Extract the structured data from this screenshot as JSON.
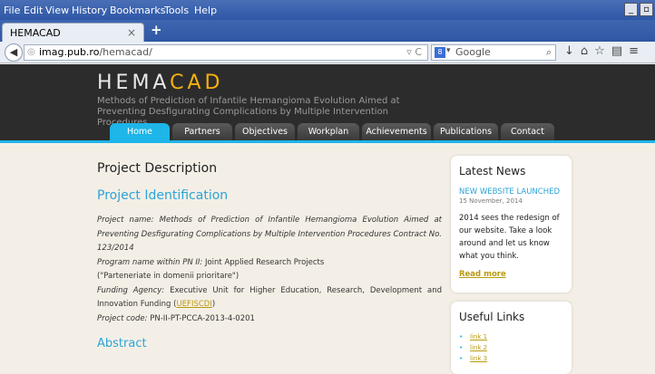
{
  "menubar": {
    "items": [
      "File",
      "Edit",
      "View",
      "History",
      "Bookmarks",
      "Tools",
      "Help"
    ]
  },
  "tab": {
    "title": "HEMACAD"
  },
  "url": {
    "host": "imag.pub.ro",
    "path": "/hemacad/"
  },
  "search": {
    "placeholder": "Google"
  },
  "site": {
    "logo_main": "HEMA",
    "logo_accent": "CAD",
    "tagline": "Methods of Prediction of Infantile Hemangioma Evolution Aimed at Preventing Desfigurating Complications by Multiple Intervention Procedures",
    "nav": [
      "Home",
      "Partners",
      "Objectives",
      "Workplan",
      "Achievements",
      "Publications",
      "Contact"
    ]
  },
  "main": {
    "title": "Project Description",
    "section1": "Project Identification",
    "p1_label": "Project name:",
    "p1_value": "Methods of Prediction of Infantile Hemangioma Evolution Aimed at Preventing Desfigurating Complications by Multiple Intervention Procedures Contract No. 123/2014",
    "p2_label": "Program name within PN II:",
    "p2_value": "Joint Applied Research Projects",
    "p3": "(\"Parteneriate in domenii prioritare\")",
    "p4_label": "Funding Agency:",
    "p4_value": "Executive Unit for Higher Education, Research, Development and Innovation Funding (",
    "p4_link": "UEFISCDI",
    "p4_end": ")",
    "p5_label": "Project code:",
    "p5_value": "PN-II-PT-PCCA-2013-4-0201",
    "section2": "Abstract"
  },
  "news": {
    "heading": "Latest News",
    "title": "NEW WEBSITE LAUNCHED",
    "date": "15 November, 2014",
    "body": "2014 sees the redesign of our website. Take a look around and let us know what you think.",
    "read_more": "Read more"
  },
  "links": {
    "heading": "Useful Links",
    "items": [
      "link 1",
      "link 2",
      "link 3"
    ]
  }
}
